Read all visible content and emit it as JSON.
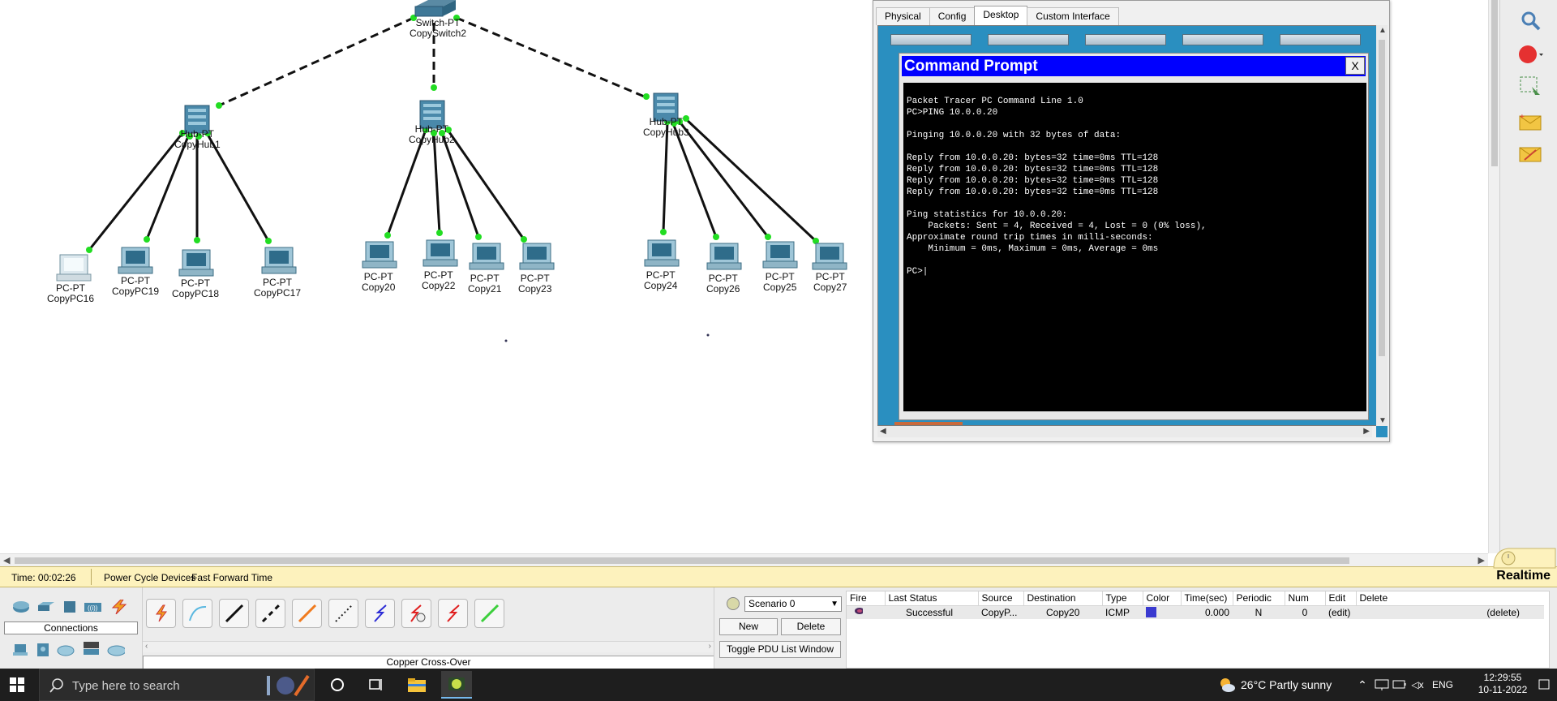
{
  "devices": {
    "switch": {
      "type": "Switch-PT",
      "name": "CopySwitch2"
    },
    "hub1": {
      "type": "Hub-PT",
      "name": "CopyHub1"
    },
    "hub2": {
      "type": "Hub-PT",
      "name": "CopyHub2"
    },
    "hub3": {
      "type": "Hub-PT",
      "name": "CopyHub3"
    },
    "pcs": [
      {
        "type": "PC-PT",
        "name": "CopyPC16"
      },
      {
        "type": "PC-PT",
        "name": "CopyPC19"
      },
      {
        "type": "PC-PT",
        "name": "CopyPC18"
      },
      {
        "type": "PC-PT",
        "name": "CopyPC17"
      },
      {
        "type": "PC-PT",
        "name": "Copy20"
      },
      {
        "type": "PC-PT",
        "name": "Copy22"
      },
      {
        "type": "PC-PT",
        "name": "Copy21"
      },
      {
        "type": "PC-PT",
        "name": "Copy23"
      },
      {
        "type": "PC-PT",
        "name": "Copy24"
      },
      {
        "type": "PC-PT",
        "name": "Copy26"
      },
      {
        "type": "PC-PT",
        "name": "Copy25"
      },
      {
        "type": "PC-PT",
        "name": "Copy27"
      }
    ]
  },
  "pc_window": {
    "tabs": [
      "Physical",
      "Config",
      "Desktop",
      "Custom Interface"
    ],
    "active_tab": "Desktop",
    "cmd_title": "Command Prompt",
    "close_label": "X",
    "console_text": "Packet Tracer PC Command Line 1.0\nPC>PING 10.0.0.20\n\nPinging 10.0.0.20 with 32 bytes of data:\n\nReply from 10.0.0.20: bytes=32 time=0ms TTL=128\nReply from 10.0.0.20: bytes=32 time=0ms TTL=128\nReply from 10.0.0.20: bytes=32 time=0ms TTL=128\nReply from 10.0.0.20: bytes=32 time=0ms TTL=128\n\nPing statistics for 10.0.0.20:\n    Packets: Sent = 4, Received = 4, Lost = 0 (0% loss),\nApproximate round trip times in milli-seconds:\n    Minimum = 0ms, Maximum = 0ms, Average = 0ms\n\nPC>|"
  },
  "statusbar": {
    "time": "Time: 00:02:26",
    "power_cycle": "Power Cycle Devices",
    "fast_forward": "Fast Forward Time",
    "mode": "Realtime"
  },
  "bottom": {
    "connections_label": "Connections",
    "cable_name": "Copper Cross-Over",
    "scenario": "Scenario 0",
    "new_label": "New",
    "delete_label": "Delete",
    "toggle_label": "Toggle PDU List Window",
    "pdu_headers": [
      "Fire",
      "Last Status",
      "Source",
      "Destination",
      "Type",
      "Color",
      "Time(sec)",
      "Periodic",
      "Num",
      "Edit",
      "Delete"
    ],
    "pdu_row": {
      "last_status": "Successful",
      "source": "CopyP...",
      "destination": "Copy20",
      "type": "ICMP",
      "color": "#3a3ad0",
      "time": "0.000",
      "periodic": "N",
      "num": "0",
      "edit": "(edit)",
      "delete": "(delete)"
    }
  },
  "taskbar": {
    "search_placeholder": "Type here to search",
    "weather": "26°C  Partly sunny",
    "lang": "ENG",
    "time": "12:29:55",
    "date": "10-11-2022"
  },
  "colors": {
    "cmd_title_bg": "#0000ff",
    "desktop_bg": "#2a8fc0",
    "statusbar_bg": "#fdf2bd",
    "link_dot": "#22dd22"
  }
}
